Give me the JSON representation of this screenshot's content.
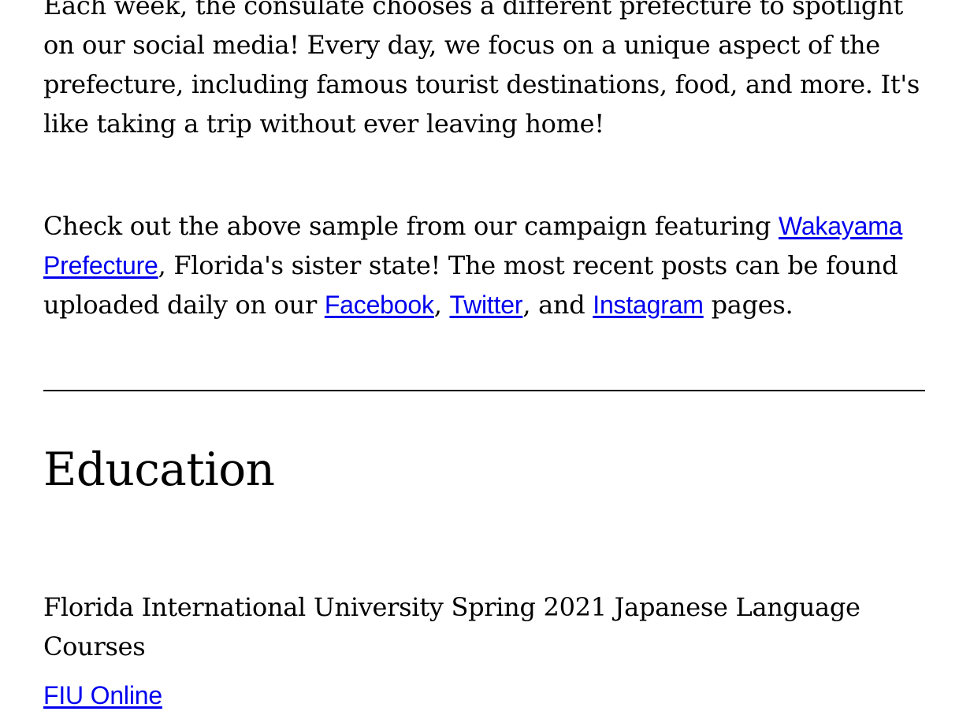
{
  "intro": {
    "text": "Each week, the consulate chooses a different prefecture to spotlight on our social media! Every day, we focus on a unique aspect of the prefecture, including famous tourist destinations, food, and more. It's like taking a trip without ever leaving home!"
  },
  "campaign": {
    "text_before": "Check out the above sample from our campaign featuring ",
    "wakayama_link": "Wakayama Prefecture",
    "text_middle": ", Florida's sister state! The most recent posts can be found uploaded daily on our ",
    "facebook_link": "Facebook",
    "sep1": ", ",
    "twitter_link": "Twitter",
    "sep2": ", and ",
    "instagram_link": "Instagram",
    "text_after": " pages."
  },
  "education": {
    "heading": "Education",
    "course_title": "Florida International University Spring 2021 Japanese Language Courses",
    "online_link": "FIU Online"
  },
  "colors": {
    "link": "#0000ee",
    "text": "#000000",
    "background": "#ffffff"
  }
}
